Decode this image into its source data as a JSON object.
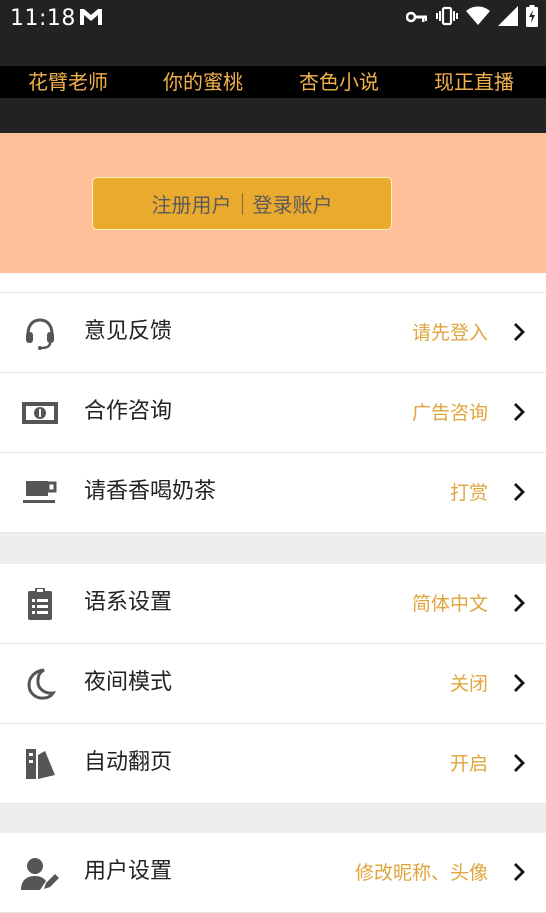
{
  "status_bar": {
    "time": "11:18",
    "icons": [
      "gmail-icon",
      "key-icon",
      "vibrate-icon",
      "wifi-icon",
      "signal-icon",
      "battery-charging-icon"
    ]
  },
  "nav": {
    "items": [
      {
        "label": "花臂老师"
      },
      {
        "label": "你的蜜桃"
      },
      {
        "label": "杏色小说"
      },
      {
        "label": "现正直播"
      }
    ]
  },
  "header": {
    "register_label": "注册用户",
    "login_label": "登录账户"
  },
  "colors": {
    "accent": "#e0a53c",
    "peach": "#ffbf98",
    "button": "#eaaa2e"
  },
  "menu": {
    "group1": [
      {
        "icon": "headset-icon",
        "label": "意见反馈",
        "value": "请先登入"
      },
      {
        "icon": "money-icon",
        "label": "合作咨询",
        "value": "广告咨询"
      },
      {
        "icon": "coffee-cup-icon",
        "label": "请香香喝奶茶",
        "value": "打赏"
      }
    ],
    "group2": [
      {
        "icon": "clipboard-icon",
        "label": "语系设置",
        "value": "简体中文"
      },
      {
        "icon": "moon-icon",
        "label": "夜间模式",
        "value": "关闭"
      },
      {
        "icon": "page-flip-icon",
        "label": "自动翻页",
        "value": "开启"
      }
    ],
    "group3": [
      {
        "icon": "user-edit-icon",
        "label": "用户设置",
        "value": "修改昵称、头像"
      }
    ]
  }
}
